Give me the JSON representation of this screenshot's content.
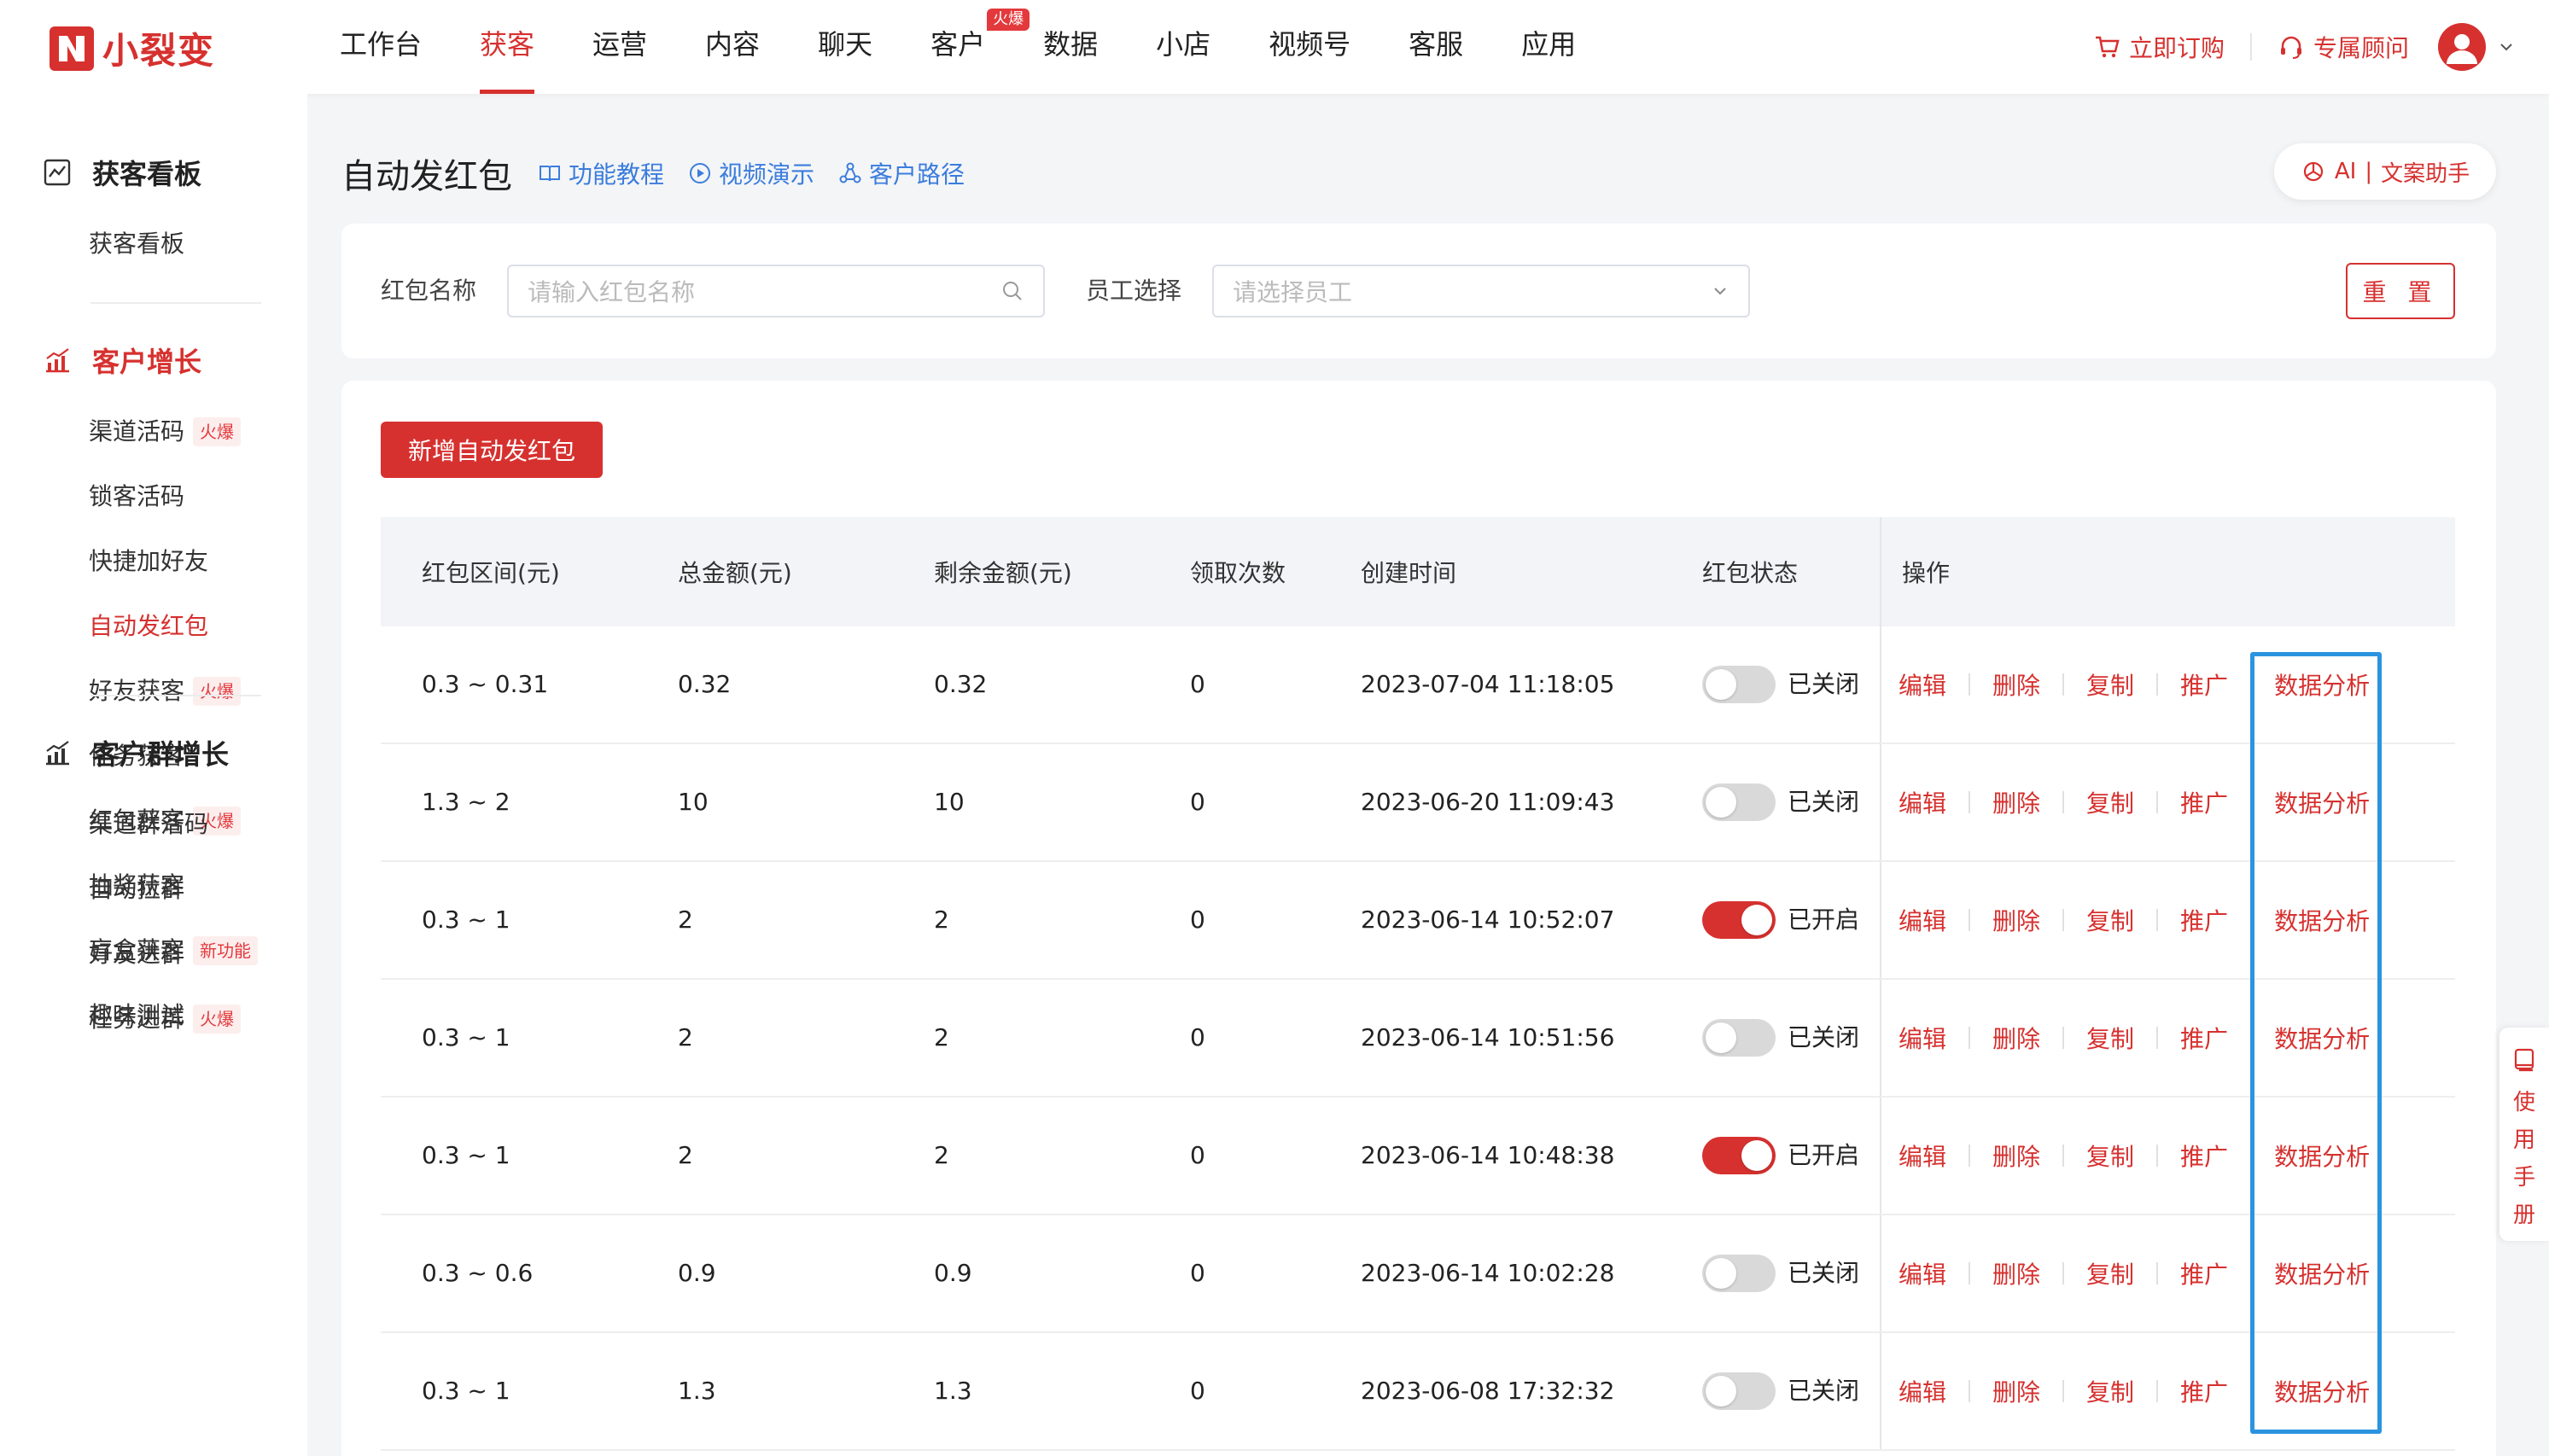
{
  "brand": {
    "name": "小裂变",
    "accent": "#d6312f"
  },
  "nav": {
    "items": [
      {
        "label": "工作台"
      },
      {
        "label": "获客",
        "active": true
      },
      {
        "label": "运营"
      },
      {
        "label": "内容"
      },
      {
        "label": "聊天"
      },
      {
        "label": "客户",
        "badge": "火爆"
      },
      {
        "label": "数据"
      },
      {
        "label": "小店"
      },
      {
        "label": "视频号"
      },
      {
        "label": "客服"
      },
      {
        "label": "应用"
      }
    ],
    "order_label": "立即订购",
    "advisor_label": "专属顾问"
  },
  "sidebar": {
    "groups": [
      {
        "title": "获客看板",
        "items": [
          {
            "label": "获客看板"
          }
        ]
      },
      {
        "title": "客户增长",
        "items": [
          {
            "label": "渠道活码",
            "tag": "火爆"
          },
          {
            "label": "锁客活码"
          },
          {
            "label": "快捷加好友"
          },
          {
            "label": "自动发红包",
            "active": true
          },
          {
            "label": "好友获客",
            "tag": "火爆"
          },
          {
            "label": "任务获客"
          },
          {
            "label": "红包获客",
            "tag": "火爆"
          },
          {
            "label": "抽奖获客"
          },
          {
            "label": "盲盒获客",
            "tag": "新功能"
          },
          {
            "label": "趣味测试"
          }
        ]
      },
      {
        "title": "客户群增长",
        "items": [
          {
            "label": "渠道群活码"
          },
          {
            "label": "自动拉群"
          },
          {
            "label": "好友进群"
          },
          {
            "label": "任务进群",
            "tag": "火爆"
          }
        ]
      }
    ]
  },
  "page": {
    "title": "自动发红包",
    "links": {
      "tutorial": "功能教程",
      "video": "视频演示",
      "path": "客户路径"
    },
    "ai": {
      "prefix": "AI",
      "label": "文案助手"
    }
  },
  "filters": {
    "name_label": "红包名称",
    "name_placeholder": "请输入红包名称",
    "staff_label": "员工选择",
    "staff_placeholder": "请选择员工",
    "reset_label": "重 置"
  },
  "table": {
    "add_button": "新增自动发红包",
    "headers": {
      "range": "红包区间(元)",
      "total": "总金额(元)",
      "remaining": "剩余金额(元)",
      "claims": "领取次数",
      "created": "创建时间",
      "status": "红包状态",
      "ops": "操作"
    },
    "ops": [
      "编辑",
      "删除",
      "复制",
      "推广",
      "数据分析"
    ],
    "status_labels": {
      "on": "已开启",
      "off": "已关闭"
    },
    "rows": [
      {
        "range": "0.3 ~ 0.31",
        "total": "0.32",
        "remaining": "0.32",
        "claims": "0",
        "created": "2023-07-04 11:18:05",
        "on": false
      },
      {
        "range": "1.3 ~ 2",
        "total": "10",
        "remaining": "10",
        "claims": "0",
        "created": "2023-06-20 11:09:43",
        "on": false
      },
      {
        "range": "0.3 ~ 1",
        "total": "2",
        "remaining": "2",
        "claims": "0",
        "created": "2023-06-14 10:52:07",
        "on": true
      },
      {
        "range": "0.3 ~ 1",
        "total": "2",
        "remaining": "2",
        "claims": "0",
        "created": "2023-06-14 10:51:56",
        "on": false
      },
      {
        "range": "0.3 ~ 1",
        "total": "2",
        "remaining": "2",
        "claims": "0",
        "created": "2023-06-14 10:48:38",
        "on": true
      },
      {
        "range": "0.3 ~ 0.6",
        "total": "0.9",
        "remaining": "0.9",
        "claims": "0",
        "created": "2023-06-14 10:02:28",
        "on": false
      },
      {
        "range": "0.3 ~ 1",
        "total": "1.3",
        "remaining": "1.3",
        "claims": "0",
        "created": "2023-06-08 17:32:32",
        "on": false
      }
    ]
  },
  "manual_tab": "使用手册",
  "highlight_color": "#2b94e0"
}
